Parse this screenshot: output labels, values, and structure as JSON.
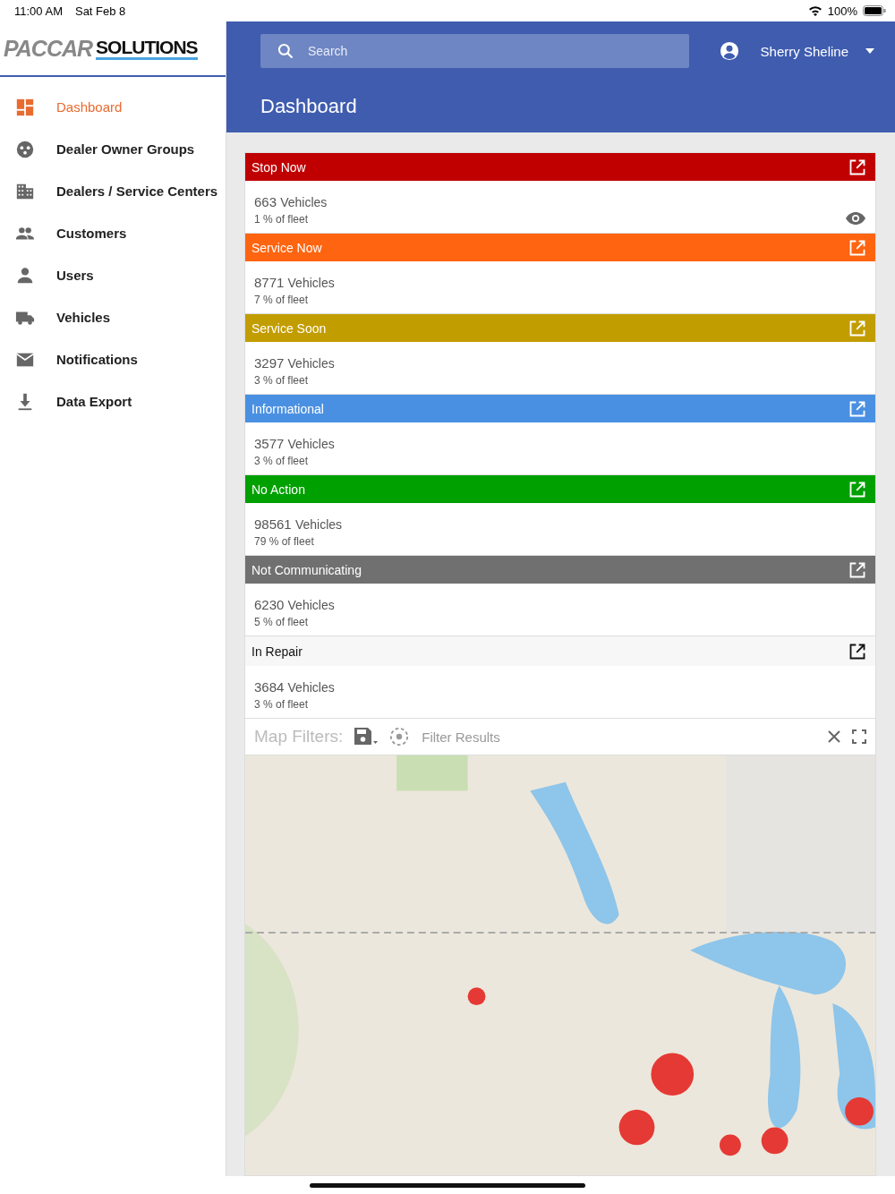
{
  "status_bar": {
    "time": "11:00 AM",
    "date": "Sat Feb 8",
    "battery": "100%"
  },
  "logo": {
    "left": "PACCAR",
    "right": "SOLUTIONS"
  },
  "sidebar": {
    "items": [
      {
        "label": "Dashboard",
        "selected": true
      },
      {
        "label": "Dealer Owner Groups",
        "selected": false
      },
      {
        "label": "Dealers / Service Centers",
        "selected": false
      },
      {
        "label": "Customers",
        "selected": false
      },
      {
        "label": "Users",
        "selected": false
      },
      {
        "label": "Vehicles",
        "selected": false
      },
      {
        "label": "Notifications",
        "selected": false
      },
      {
        "label": "Data Export",
        "selected": false
      }
    ]
  },
  "header": {
    "search": {
      "placeholder": "Search"
    },
    "user": "Sherry Sheline",
    "title": "Dashboard"
  },
  "cards": [
    {
      "kind": "filled",
      "title": "Stop Now",
      "color": "#c00000",
      "count": "663",
      "unit": "Vehicles",
      "share": "1 % of fleet",
      "watched": true
    },
    {
      "kind": "filled",
      "title": "Service Now",
      "color": "#ff6410",
      "count": "8771",
      "unit": "Vehicles",
      "share": "7 % of fleet",
      "watched": false
    },
    {
      "kind": "filled",
      "title": "Service Soon",
      "color": "#c29d00",
      "count": "3297",
      "unit": "Vehicles",
      "share": "3 % of fleet",
      "watched": false
    },
    {
      "kind": "filled",
      "title": "Informational",
      "color": "#4a90e2",
      "count": "3577",
      "unit": "Vehicles",
      "share": "3 % of fleet",
      "watched": false
    },
    {
      "kind": "filled",
      "title": "No Action",
      "color": "#00a000",
      "count": "98561",
      "unit": "Vehicles",
      "share": "79 % of fleet",
      "watched": false
    },
    {
      "kind": "filled",
      "title": "Not Communicating",
      "color": "#707070",
      "count": "6230",
      "unit": "Vehicles",
      "share": "5 % of fleet",
      "watched": false
    },
    {
      "kind": "plain",
      "title": "In Repair",
      "color": "#f7f7f7",
      "count": "3684",
      "unit": "Vehicles",
      "share": "3 % of fleet",
      "watched": false
    }
  ],
  "map": {
    "label": "Map Filters:",
    "filter_placeholder": "Filter Results",
    "kind": "picture"
  }
}
